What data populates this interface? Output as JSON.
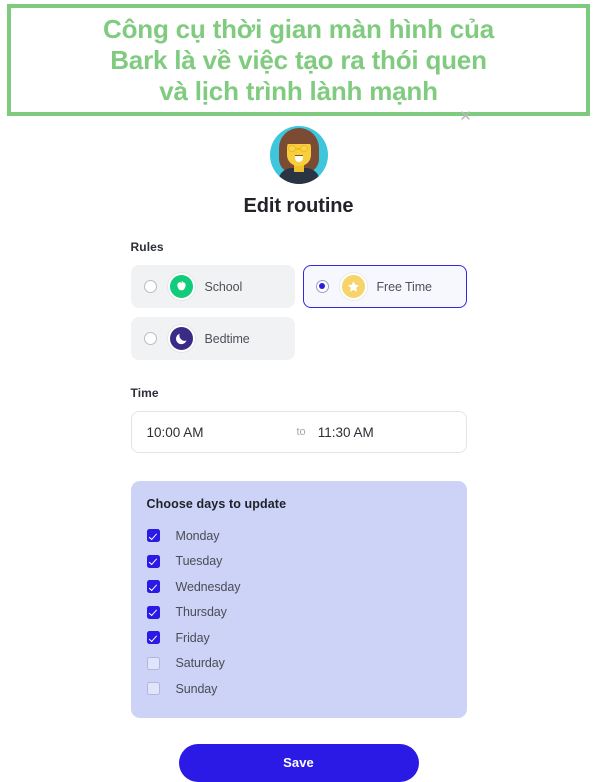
{
  "banner": {
    "text": "Công cụ thời gian màn hình của\nBark là về việc tạo ra thói quen\nvà lịch trình lành mạnh",
    "border_color": "#7ecb7e",
    "text_color": "#80cb80",
    "artifact_glyph": "✕"
  },
  "app": {
    "avatar_name": "woman-with-glasses-avatar",
    "title": "Edit routine",
    "rules": {
      "label": "Rules",
      "options": [
        {
          "label": "School",
          "icon": "apple-icon",
          "icon_color": "#12cb7b",
          "selected": false
        },
        {
          "label": "Free Time",
          "icon": "star-icon",
          "icon_color": "#f6d469",
          "selected": true
        },
        {
          "label": "Bedtime",
          "icon": "moon-icon",
          "icon_color": "#3a2c86",
          "selected": false
        }
      ]
    },
    "time": {
      "label": "Time",
      "start": "10:00 AM",
      "separator": "to",
      "end": "11:30 AM"
    },
    "days": {
      "title": "Choose days to update",
      "panel_color": "#ccd3f7",
      "items": [
        {
          "label": "Monday",
          "checked": true
        },
        {
          "label": "Tuesday",
          "checked": true
        },
        {
          "label": "Wednesday",
          "checked": true
        },
        {
          "label": "Thursday",
          "checked": true
        },
        {
          "label": "Friday",
          "checked": true
        },
        {
          "label": "Saturday",
          "checked": false
        },
        {
          "label": "Sunday",
          "checked": false
        }
      ]
    },
    "save": {
      "label": "Save",
      "color": "#2b19e6"
    }
  }
}
